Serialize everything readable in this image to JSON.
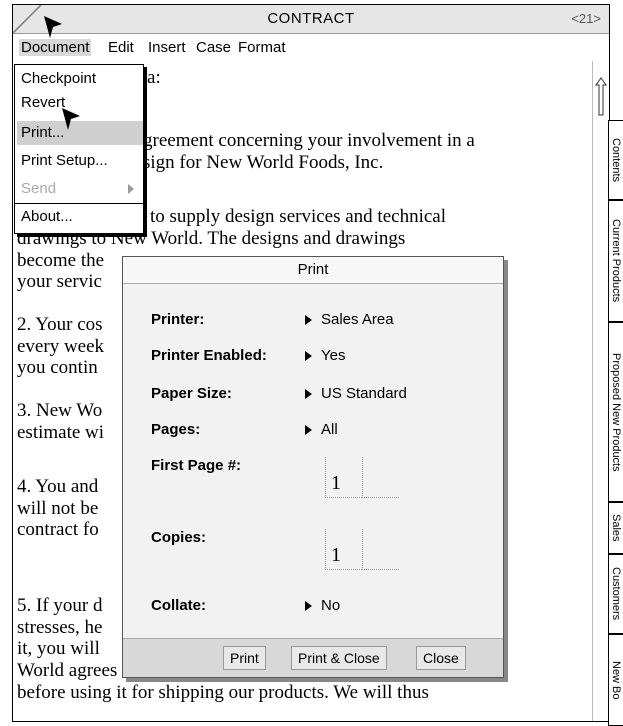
{
  "window": {
    "title": "CONTRACT",
    "page_indicator": "<21>"
  },
  "menubar": [
    "Document",
    "Edit",
    "Insert",
    "Case",
    "Format"
  ],
  "document_menu": {
    "items": [
      "Checkpoint",
      "Revert",
      "Print...",
      "Print Setup...",
      "Send",
      "About..."
    ],
    "highlighted": "Print...",
    "disabled": [
      "Send"
    ]
  },
  "document_lines": [
    "erta:",
    "greement concerning your involvement in a",
    "sign for New World Foods, Inc.",
    "to supply design services and technical",
    "drawings to New World. The designs and drawings",
    "become the",
    "your servic",
    "2. Your cos",
    "every week",
    "you contin",
    "3. New Wo",
    "estimate wi",
    "4. You and",
    "will not be",
    "contract fo",
    "5. If your d",
    "stresses, he",
    "it, you will",
    "World agrees to submit the design to adequate testing",
    "before using it for shipping our products. We will thus"
  ],
  "side_tabs": [
    "Contents",
    "Current Products",
    "Proposed New Products",
    "Sales",
    "Customers",
    "New Bo"
  ],
  "print_dialog": {
    "title": "Print",
    "printer_label": "Printer:",
    "printer_value": "Sales Area",
    "enabled_label": "Printer Enabled:",
    "enabled_value": "Yes",
    "paper_label": "Paper Size:",
    "paper_value": "US Standard",
    "pages_label": "Pages:",
    "pages_value": "All",
    "first_page_label": "First Page #:",
    "first_page_value": "1",
    "copies_label": "Copies:",
    "copies_value": "1",
    "collate_label": "Collate:",
    "collate_value": "No",
    "buttons": [
      "Print",
      "Print & Close",
      "Close"
    ]
  }
}
